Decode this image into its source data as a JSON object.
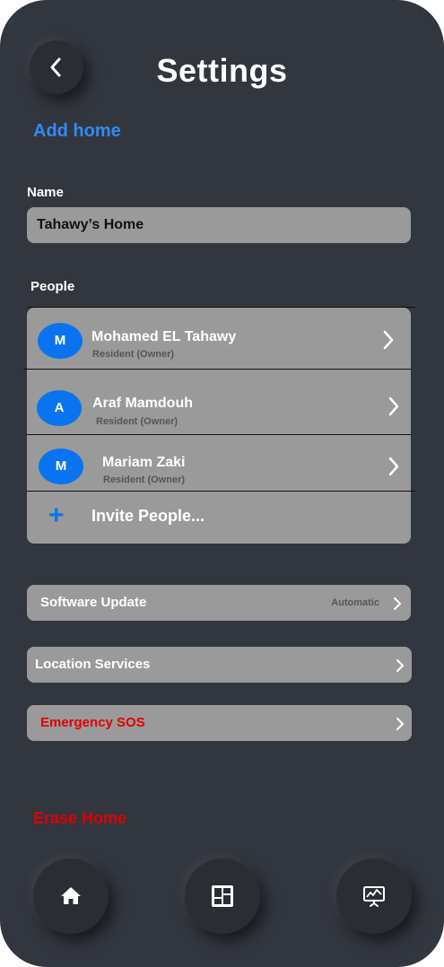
{
  "header": {
    "title": "Settings",
    "back_icon": "chevron-left-icon"
  },
  "add_home_label": "Add home",
  "name_section": {
    "label": "Name",
    "value": "Tahawy’s Home",
    "placeholder": ""
  },
  "people_section": {
    "label": "People",
    "people": [
      {
        "initial": "M",
        "name": "Mohamed EL Tahawy",
        "role": "Resident (Owner)"
      },
      {
        "initial": "A",
        "name": "Araf Mamdouh",
        "role": "Resident (Owner)"
      },
      {
        "initial": "M",
        "name": "Mariam Zaki",
        "role": "Resident (Owner)"
      }
    ],
    "invite_label": "Invite People..."
  },
  "settings": {
    "software_update": {
      "label": "Software Update",
      "value": "Automatic"
    },
    "location_services": {
      "label": "Location Services"
    },
    "emergency_sos": {
      "label": "Emergency SOS"
    }
  },
  "erase_home_label": "Erase Home",
  "bottom_nav": {
    "items": [
      {
        "icon": "home-icon"
      },
      {
        "icon": "dashboard-icon"
      },
      {
        "icon": "presentation-chart-icon"
      }
    ]
  },
  "colors": {
    "background": "#32363f",
    "card": "#9a9a9a",
    "accent_blue": "#2f8cf5",
    "avatar_blue": "#0a74f0",
    "danger_red": "#e00000"
  }
}
